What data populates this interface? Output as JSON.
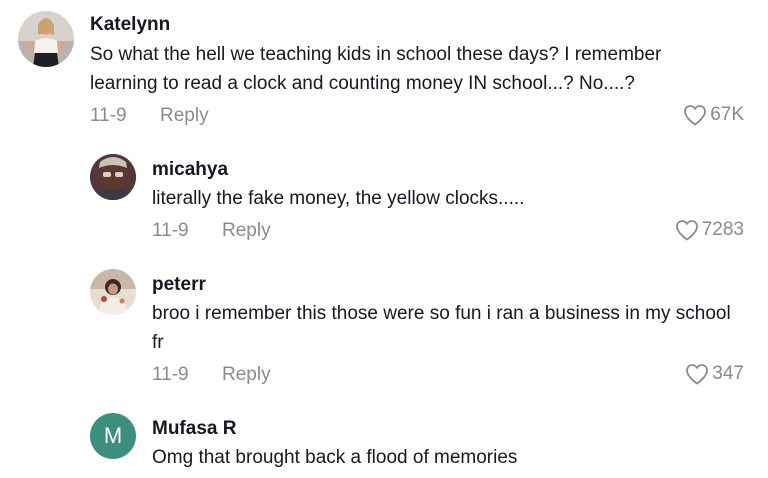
{
  "comments": [
    {
      "username": "Katelynn",
      "text": "So what the hell we teaching kids in school these days? I remember learning to read a clock and counting money IN school...? No....?",
      "date": "11-9",
      "reply_label": "Reply",
      "likes": "67K",
      "avatar_icon": "photo-avatar-icon"
    },
    {
      "username": "micahya",
      "text": "literally the fake money, the yellow clocks.....",
      "date": "11-9",
      "reply_label": "Reply",
      "likes": "7283",
      "avatar_icon": "photo-avatar-icon"
    },
    {
      "username": "peterr",
      "text": "broo i remember this those were so fun i ran a business in my school fr",
      "date": "11-9",
      "reply_label": "Reply",
      "likes": "347",
      "avatar_icon": "photo-avatar-icon"
    },
    {
      "username": "Mufasa R",
      "text": "Omg that brought back a flood of memories",
      "avatar_letter": "M",
      "avatar_color": "#3a8f7e"
    }
  ],
  "colors": {
    "primary_text": "#161823",
    "secondary_text": "#8a8b91",
    "background": "#ffffff"
  },
  "icons": {
    "like": "heart-outline-icon"
  }
}
